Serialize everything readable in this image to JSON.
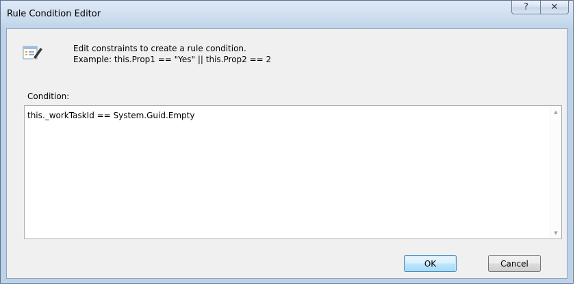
{
  "window": {
    "title": "Rule Condition Editor",
    "help_glyph": "?",
    "close_glyph": "✕"
  },
  "header": {
    "icon": "rule-edit-icon",
    "line1": "Edit constraints to create a rule condition.",
    "line2": "Example: this.Prop1 == \"Yes\" || this.Prop2 == 2"
  },
  "condition": {
    "label": "Condition:",
    "value": "this._workTaskId == System.Guid.Empty",
    "scroll_up_glyph": "▲",
    "scroll_down_glyph": "▼"
  },
  "buttons": {
    "ok_label": "OK",
    "cancel_label": "Cancel"
  }
}
